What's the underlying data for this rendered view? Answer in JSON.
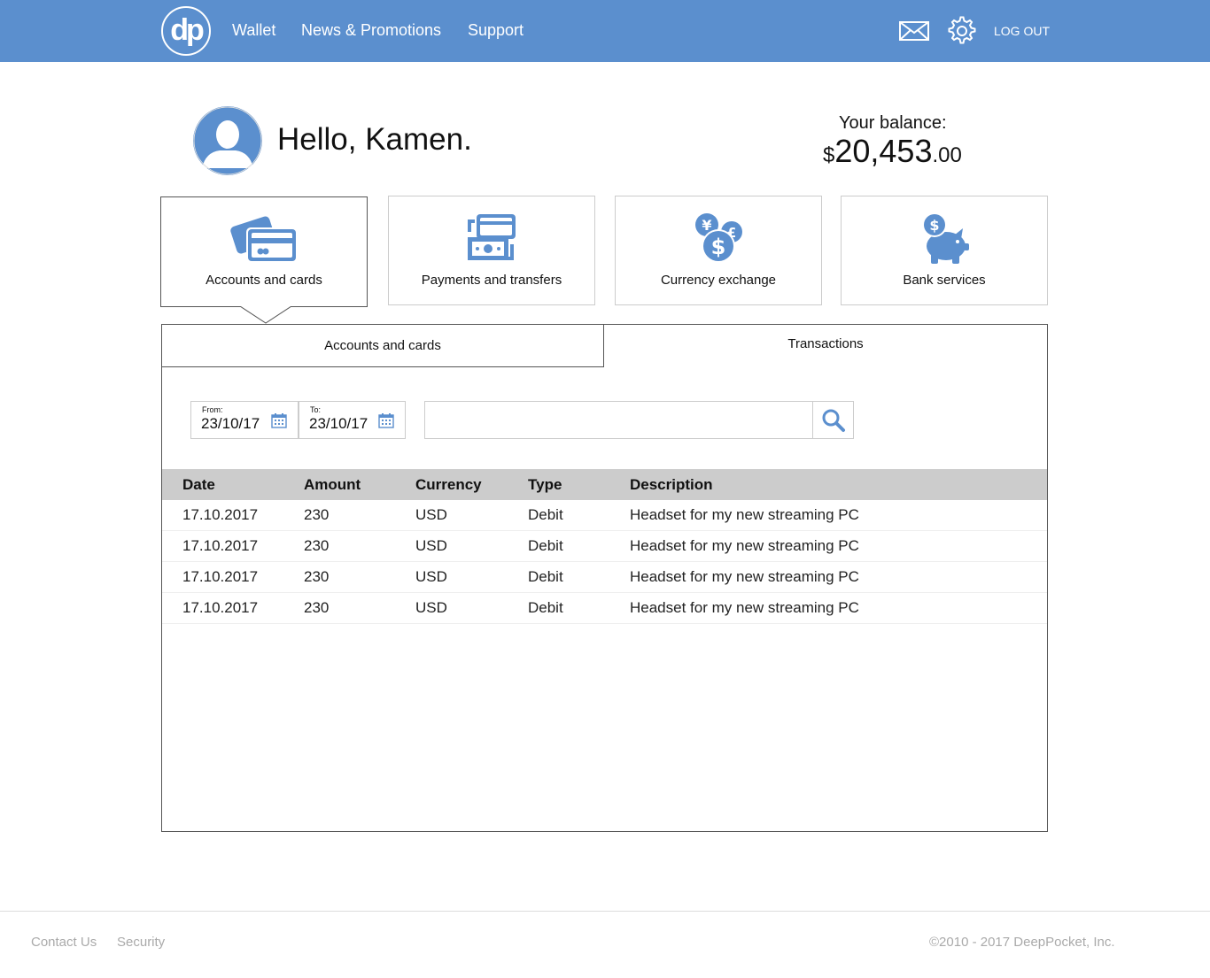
{
  "header": {
    "logo_text": "dp",
    "nav": [
      "Wallet",
      "News & Promotions",
      "Support"
    ],
    "mail_icon": "mail-icon",
    "settings_icon": "gear-icon",
    "logout_label": "LOG OUT",
    "background_color": "#5b8fce"
  },
  "user": {
    "greeting": "Hello, Kamen.",
    "avatar_icon": "user-avatar-icon"
  },
  "balance": {
    "label": "Your balance:",
    "currency_symbol": "$",
    "integer": "20,453",
    "decimal": ".00"
  },
  "tiles": [
    {
      "label": "Accounts and cards",
      "icon": "cards-icon",
      "active": true
    },
    {
      "label": "Payments and transfers",
      "icon": "payments-icon",
      "active": false
    },
    {
      "label": "Currency exchange",
      "icon": "currency-exchange-icon",
      "active": false
    },
    {
      "label": "Bank services",
      "icon": "piggy-bank-icon",
      "active": false
    }
  ],
  "tabs": {
    "accounts": "Accounts and cards",
    "transactions": "Transactions",
    "active": "Transactions"
  },
  "filters": {
    "from_label": "From:",
    "from_value": "23/10/17",
    "to_label": "To:",
    "to_value": "23/10/17",
    "search_value": "",
    "search_icon": "search-icon",
    "calendar_icon": "calendar-icon"
  },
  "table": {
    "headers": [
      "Date",
      "Amount",
      "Currency",
      "Type",
      "Description"
    ],
    "rows": [
      [
        "17.10.2017",
        "230",
        "USD",
        "Debit",
        "Headset for my new streaming PC"
      ],
      [
        "17.10.2017",
        "230",
        "USD",
        "Debit",
        "Headset for my new streaming PC"
      ],
      [
        "17.10.2017",
        "230",
        "USD",
        "Debit",
        "Headset for my new streaming PC"
      ],
      [
        "17.10.2017",
        "230",
        "USD",
        "Debit",
        "Headset for my new streaming PC"
      ]
    ]
  },
  "footer": {
    "links": [
      "Contact Us",
      "Security"
    ],
    "copyright": "©2010 - 2017 DeepPocket, Inc."
  },
  "colors": {
    "accent": "#5b8fce",
    "table_header": "#cccccc",
    "footer_text": "#aaaaaa"
  }
}
